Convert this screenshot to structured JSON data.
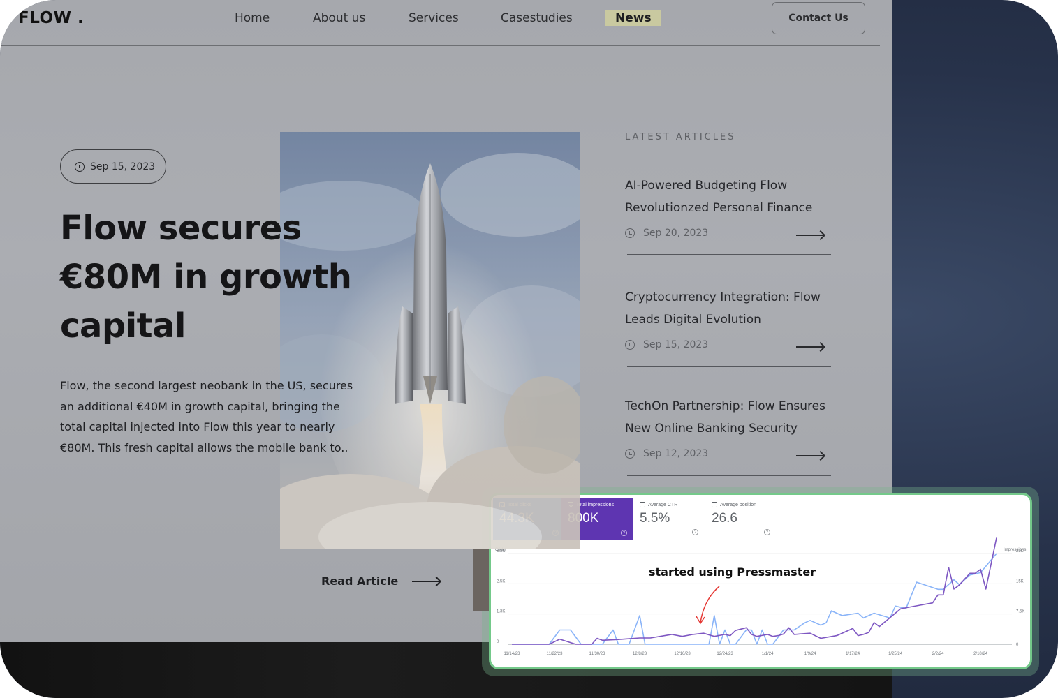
{
  "nav": {
    "logo": "FLOW .",
    "items": [
      "Home",
      "About us",
      "Services",
      "Casestudies",
      "News"
    ],
    "active_item": "News",
    "contact_button": "Contact Us"
  },
  "hero": {
    "date": "Sep 15, 2023",
    "headline": "Flow secures €80M in growth capital",
    "excerpt": "Flow, the second largest neobank in the US, secures an additional €40M in growth capital, bringing the total capital injected into Flow this year to nearly €80M. This fresh capital allows the mobile bank to..",
    "read_more": "Read Article",
    "image_alt": "rocket launching through clouds"
  },
  "latest": {
    "label": "LATEST ARTICLES",
    "articles": [
      {
        "title": "AI-Powered Budgeting Flow Revolutionzed Personal Finance",
        "date": "Sep 20, 2023"
      },
      {
        "title": "Cryptocurrency Integration: Flow Leads Digital Evolution",
        "date": "Sep 15, 2023"
      },
      {
        "title": "TechOn Partnership: Flow Ensures New Online Banking Security",
        "date": "Sep 12, 2023"
      }
    ]
  },
  "metrics": [
    {
      "label": "Total clicks",
      "value": "44.3K",
      "checked": true
    },
    {
      "label": "Total impressions",
      "value": "800K",
      "checked": true
    },
    {
      "label": "Average CTR",
      "value": "5.5%",
      "checked": false
    },
    {
      "label": "Average position",
      "value": "26.6",
      "checked": false
    }
  ],
  "colors": {
    "clicks": "#8ab4f8",
    "impressions": "#7e57c2",
    "card_border": "#74c98a",
    "annotation_arrow": "#e53935"
  },
  "chart_data": {
    "type": "line",
    "title": "",
    "annotation": "started using Pressmaster",
    "annotation_x": "12/19/23",
    "x_ticks": [
      "11/14/23",
      "11/22/23",
      "11/30/23",
      "12/8/23",
      "12/16/23",
      "12/24/23",
      "1/1/24",
      "1/9/24",
      "1/17/24",
      "1/25/24",
      "2/2/24",
      "2/10/24"
    ],
    "x_range_days": [
      0,
      91
    ],
    "y_left": {
      "label": "Clicks",
      "ticks": [
        "0",
        "1.3K",
        "2.5K",
        "3.8K"
      ],
      "range": [
        0,
        3.8
      ]
    },
    "y_right": {
      "label": "Impressions",
      "ticks": [
        "0",
        "7.5K",
        "15K",
        "23K"
      ],
      "range": [
        0,
        23
      ]
    },
    "grid": true,
    "series": [
      {
        "name": "Clicks",
        "axis": "left",
        "unit": "K",
        "x_days": [
          0,
          7,
          9,
          11,
          13,
          15,
          17,
          19,
          20,
          21,
          22,
          24,
          25,
          27,
          30,
          32,
          33,
          37,
          38,
          39,
          40,
          41,
          42,
          44,
          45,
          46,
          47,
          48,
          49,
          51,
          52,
          53,
          55,
          56,
          58,
          59,
          60,
          62,
          65,
          66,
          68,
          71,
          72,
          74,
          76,
          80,
          81,
          83,
          84,
          86,
          88,
          91
        ],
        "values": [
          0,
          0,
          0.6,
          0.6,
          0,
          0,
          0,
          0.6,
          0,
          0,
          0,
          1.2,
          0,
          0,
          0,
          0,
          0,
          0,
          1.2,
          0,
          0.6,
          0,
          0,
          0.6,
          0.6,
          0,
          0.6,
          0,
          0,
          0.6,
          0.6,
          0.6,
          0.9,
          1.0,
          0.8,
          0.9,
          1.4,
          1.2,
          1.3,
          1.1,
          1.3,
          1.1,
          1.6,
          1.5,
          2.6,
          2.3,
          2.3,
          2.7,
          2.5,
          2.9,
          3.0,
          3.8
        ]
      },
      {
        "name": "Impressions",
        "axis": "right",
        "unit": "K",
        "x_days": [
          0,
          7,
          9,
          12,
          15,
          16,
          17,
          20,
          22,
          24,
          26,
          30,
          32,
          34,
          36,
          38,
          40,
          41,
          42,
          44,
          45,
          46,
          48,
          49,
          50,
          51,
          52,
          53,
          56,
          58,
          61,
          64,
          65,
          66,
          67,
          68,
          69,
          73,
          77,
          79,
          80,
          81,
          82,
          83,
          84,
          86,
          87,
          88,
          89,
          91
        ],
        "values": [
          0,
          0,
          1.3,
          0,
          0,
          1.5,
          1.0,
          1.2,
          1.4,
          1.6,
          1.6,
          2.5,
          2.0,
          2.5,
          2.8,
          2.0,
          2.5,
          2.2,
          3.5,
          4.2,
          2.5,
          2.0,
          2.5,
          2.0,
          2.2,
          2.6,
          4.2,
          2.5,
          2.8,
          1.5,
          2.2,
          4.0,
          2.2,
          2.5,
          3.0,
          5.5,
          4.5,
          9.0,
          10.0,
          10.5,
          12.5,
          12.5,
          19.5,
          14.0,
          15.0,
          18.0,
          18.0,
          19.0,
          14.0,
          27.0
        ]
      }
    ]
  }
}
